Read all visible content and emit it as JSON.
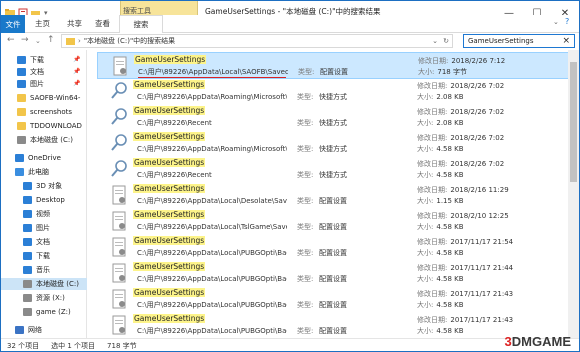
{
  "titlebar": {
    "context_tab": "搜索工具",
    "title": "GameUserSettings - \"本地磁盘 (C:)\"中的搜索结果",
    "minimize": "—",
    "maximize": "☐",
    "close": "✕"
  },
  "ribbon": {
    "tabs": [
      "文件",
      "主页",
      "共享",
      "查看"
    ],
    "active_tab": "搜索",
    "file_label": "文件"
  },
  "address": {
    "path": "\"本地磁盘 (C:)\"中的搜索结果",
    "search_value": "GameUserSettings"
  },
  "sidebar": {
    "items": [
      {
        "label": "下载",
        "icon": "download-icon",
        "pinned": true
      },
      {
        "label": "文档",
        "icon": "document-icon",
        "pinned": true
      },
      {
        "label": "图片",
        "icon": "pictures-icon",
        "pinned": true
      },
      {
        "label": "SAOFB-Win64-",
        "icon": "folder-icon",
        "pinned": false
      },
      {
        "label": "screenshots",
        "icon": "folder-icon",
        "pinned": false
      },
      {
        "label": "TDDOWNLOAD",
        "icon": "folder-icon",
        "pinned": false
      },
      {
        "label": "本地磁盘 (C:)",
        "icon": "drive-icon",
        "pinned": false
      },
      {
        "label": "OneDrive",
        "icon": "cloud-icon",
        "pinned": false
      },
      {
        "label": "此电脑",
        "icon": "computer-icon",
        "pinned": false
      },
      {
        "label": "3D 对象",
        "icon": "3d-icon",
        "pinned": false
      },
      {
        "label": "Desktop",
        "icon": "desktop-icon",
        "pinned": false
      },
      {
        "label": "视频",
        "icon": "video-icon",
        "pinned": false
      },
      {
        "label": "图片",
        "icon": "pictures-icon",
        "pinned": false
      },
      {
        "label": "文档",
        "icon": "document-icon",
        "pinned": false
      },
      {
        "label": "下载",
        "icon": "download-icon",
        "pinned": false
      },
      {
        "label": "音乐",
        "icon": "music-icon",
        "pinned": false
      },
      {
        "label": "本地磁盘 (C:)",
        "icon": "drive-icon",
        "pinned": false
      },
      {
        "label": "资源 (X:)",
        "icon": "drive-icon",
        "pinned": false
      },
      {
        "label": "game (Z:)",
        "icon": "drive-icon",
        "pinned": false
      },
      {
        "label": "网络",
        "icon": "network-icon",
        "pinned": false
      }
    ]
  },
  "results": [
    {
      "name": "GameUserSettings",
      "path": "C:\\用户\\89226\\AppData\\Local\\SAOFB\\Saved\\Co...",
      "type": "配置设置",
      "date": "2018/2/26 7:12",
      "size": "718 字节",
      "icon": "settings-file-icon"
    },
    {
      "name": "GameUserSettings",
      "path": "C:\\用户\\89226\\AppData\\Roaming\\Microsoft\\Wi...",
      "type": "快捷方式",
      "date": "2018/2/26 7:02",
      "size": "2.08 KB",
      "icon": "search-shortcut-icon"
    },
    {
      "name": "GameUserSettings",
      "path": "C:\\用户\\89226\\Recent",
      "type": "快捷方式",
      "date": "2018/2/26 7:02",
      "size": "2.08 KB",
      "icon": "search-shortcut-icon"
    },
    {
      "name": "GameUserSettings",
      "path": "C:\\用户\\89226\\AppData\\Roaming\\Microsoft\\Wi...",
      "type": "快捷方式",
      "date": "2018/2/26 7:02",
      "size": "4.58 KB",
      "icon": "search-shortcut-icon"
    },
    {
      "name": "GameUserSettings",
      "path": "C:\\用户\\89226\\Recent",
      "type": "快捷方式",
      "date": "2018/2/26 7:02",
      "size": "4.58 KB",
      "icon": "search-shortcut-icon"
    },
    {
      "name": "GameUserSettings",
      "path": "C:\\用户\\89226\\AppData\\Local\\Desolate\\Saved\\...",
      "type": "配置设置",
      "date": "2018/2/16 11:29",
      "size": "1.15 KB",
      "icon": "settings-file-icon"
    },
    {
      "name": "GameUserSettings",
      "path": "C:\\用户\\89226\\AppData\\Local\\TslGame\\Saved\\...",
      "type": "配置设置",
      "date": "2018/2/10 12:25",
      "size": "4.58 KB",
      "icon": "settings-file-icon"
    },
    {
      "name": "GameUserSettings",
      "path": "C:\\用户\\89226\\AppData\\Local\\PUBGOpti\\Backu...",
      "type": "配置设置",
      "date": "2017/11/17 21:54",
      "size": "4.58 KB",
      "icon": "settings-file-icon"
    },
    {
      "name": "GameUserSettings",
      "path": "C:\\用户\\89226\\AppData\\Local\\PUBGOpti\\Backu...",
      "type": "配置设置",
      "date": "2017/11/17 21:44",
      "size": "4.58 KB",
      "icon": "settings-file-icon"
    },
    {
      "name": "GameUserSettings",
      "path": "C:\\用户\\89226\\AppData\\Local\\PUBGOpti\\Backu...",
      "type": "配置设置",
      "date": "2017/11/17 21:43",
      "size": "4.58 KB",
      "icon": "settings-file-icon"
    },
    {
      "name": "GameUserSettings",
      "path": "C:\\用户\\89226\\AppData\\Local\\PUBGOpti\\Backu...",
      "type": "配置设置",
      "date": "2017/11/17 21:43",
      "size": "4.58 KB",
      "icon": "settings-file-icon"
    }
  ],
  "labels": {
    "type_label": "类型:",
    "date_label": "修改日期:",
    "size_label": "大小:"
  },
  "status": {
    "count": "32 个项目",
    "selected": "选中 1 个项目",
    "size": "718 字节"
  },
  "watermark": {
    "text": "3DMGAME"
  },
  "colors": {
    "accent": "#1979ca",
    "context_tab": "#f7e49a",
    "selection": "#cce8ff",
    "highlight": "#fdf48a"
  }
}
